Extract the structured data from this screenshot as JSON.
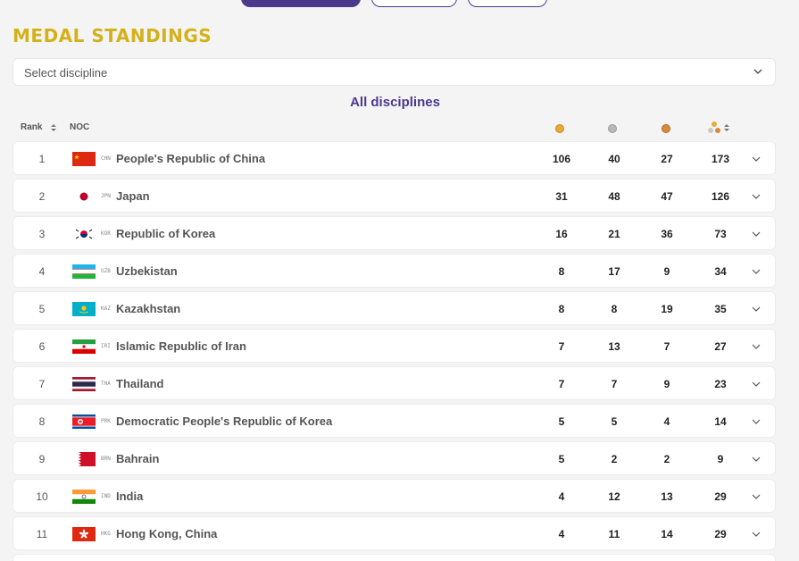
{
  "page": {
    "title": "MEDAL STANDINGS",
    "select_placeholder": "Select discipline",
    "subtitle": "All disciplines"
  },
  "table": {
    "columns": {
      "rank": "Rank",
      "noc": "NOC"
    },
    "column_icons": [
      "gold-medal-icon",
      "silver-medal-icon",
      "bronze-medal-icon",
      "total-medals-icon"
    ],
    "rows": [
      {
        "rank": "1",
        "code": "CHN",
        "name": "People's Republic of China",
        "gold": "106",
        "silver": "40",
        "bronze": "27",
        "total": "173"
      },
      {
        "rank": "2",
        "code": "JPN",
        "name": "Japan",
        "gold": "31",
        "silver": "48",
        "bronze": "47",
        "total": "126"
      },
      {
        "rank": "3",
        "code": "KOR",
        "name": "Republic of Korea",
        "gold": "16",
        "silver": "21",
        "bronze": "36",
        "total": "73"
      },
      {
        "rank": "4",
        "code": "UZB",
        "name": "Uzbekistan",
        "gold": "8",
        "silver": "17",
        "bronze": "9",
        "total": "34"
      },
      {
        "rank": "5",
        "code": "KAZ",
        "name": "Kazakhstan",
        "gold": "8",
        "silver": "8",
        "bronze": "19",
        "total": "35"
      },
      {
        "rank": "6",
        "code": "IRI",
        "name": "Islamic Republic of Iran",
        "gold": "7",
        "silver": "13",
        "bronze": "7",
        "total": "27"
      },
      {
        "rank": "7",
        "code": "THA",
        "name": "Thailand",
        "gold": "7",
        "silver": "7",
        "bronze": "9",
        "total": "23"
      },
      {
        "rank": "8",
        "code": "PRK",
        "name": "Democratic People's Republic of Korea",
        "gold": "5",
        "silver": "5",
        "bronze": "4",
        "total": "14"
      },
      {
        "rank": "9",
        "code": "BRN",
        "name": "Bahrain",
        "gold": "5",
        "silver": "2",
        "bronze": "2",
        "total": "9"
      },
      {
        "rank": "10",
        "code": "IND",
        "name": "India",
        "gold": "4",
        "silver": "12",
        "bronze": "13",
        "total": "29"
      },
      {
        "rank": "11",
        "code": "HKG",
        "name": "Hong Kong, China",
        "gold": "4",
        "silver": "11",
        "bronze": "14",
        "total": "29"
      }
    ]
  },
  "colors": {
    "title": "#d4b11a",
    "accent": "#4b3a8c",
    "gold": "#e8a93a",
    "silver": "#b8b8b8",
    "bronze": "#d88a3c"
  }
}
